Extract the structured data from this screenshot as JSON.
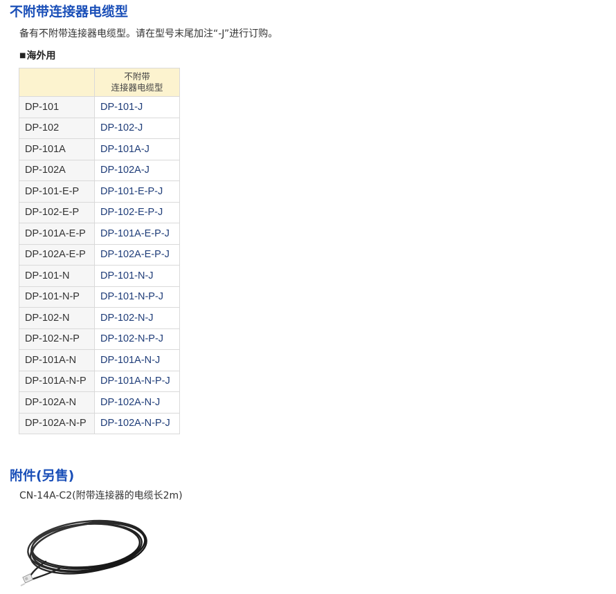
{
  "section1": {
    "title": "不附带连接器电缆型",
    "intro": "备有不附带连接器电缆型。请在型号末尾加注“-J”进行订购。",
    "subheading": "海外用",
    "subheading_marker": "■",
    "table": {
      "header_col1": "",
      "header_col2_line1": "不附带",
      "header_col2_line2": "连接器电缆型",
      "rows": [
        {
          "std": "DP-101",
          "j": "DP-101-J"
        },
        {
          "std": "DP-102",
          "j": "DP-102-J"
        },
        {
          "std": "DP-101A",
          "j": "DP-101A-J"
        },
        {
          "std": "DP-102A",
          "j": "DP-102A-J"
        },
        {
          "std": "DP-101-E-P",
          "j": "DP-101-E-P-J"
        },
        {
          "std": "DP-102-E-P",
          "j": "DP-102-E-P-J"
        },
        {
          "std": "DP-101A-E-P",
          "j": "DP-101A-E-P-J"
        },
        {
          "std": "DP-102A-E-P",
          "j": "DP-102A-E-P-J"
        },
        {
          "std": "DP-101-N",
          "j": "DP-101-N-J"
        },
        {
          "std": "DP-101-N-P",
          "j": "DP-101-N-P-J"
        },
        {
          "std": "DP-102-N",
          "j": "DP-102-N-J"
        },
        {
          "std": "DP-102-N-P",
          "j": "DP-102-N-P-J"
        },
        {
          "std": "DP-101A-N",
          "j": "DP-101A-N-J"
        },
        {
          "std": "DP-101A-N-P",
          "j": "DP-101A-N-P-J"
        },
        {
          "std": "DP-102A-N",
          "j": "DP-102A-N-J"
        },
        {
          "std": "DP-102A-N-P",
          "j": "DP-102A-N-P-J"
        }
      ]
    }
  },
  "section2": {
    "title": "附件(另售)",
    "item": "CN-14A-C2(附带连接器的电缆长2m)"
  },
  "colors": {
    "heading_blue": "#1a4fb8",
    "header_bg": "#fcf3cf",
    "model_j_text": "#1e3c78",
    "cell_border": "#d9d9d9"
  }
}
